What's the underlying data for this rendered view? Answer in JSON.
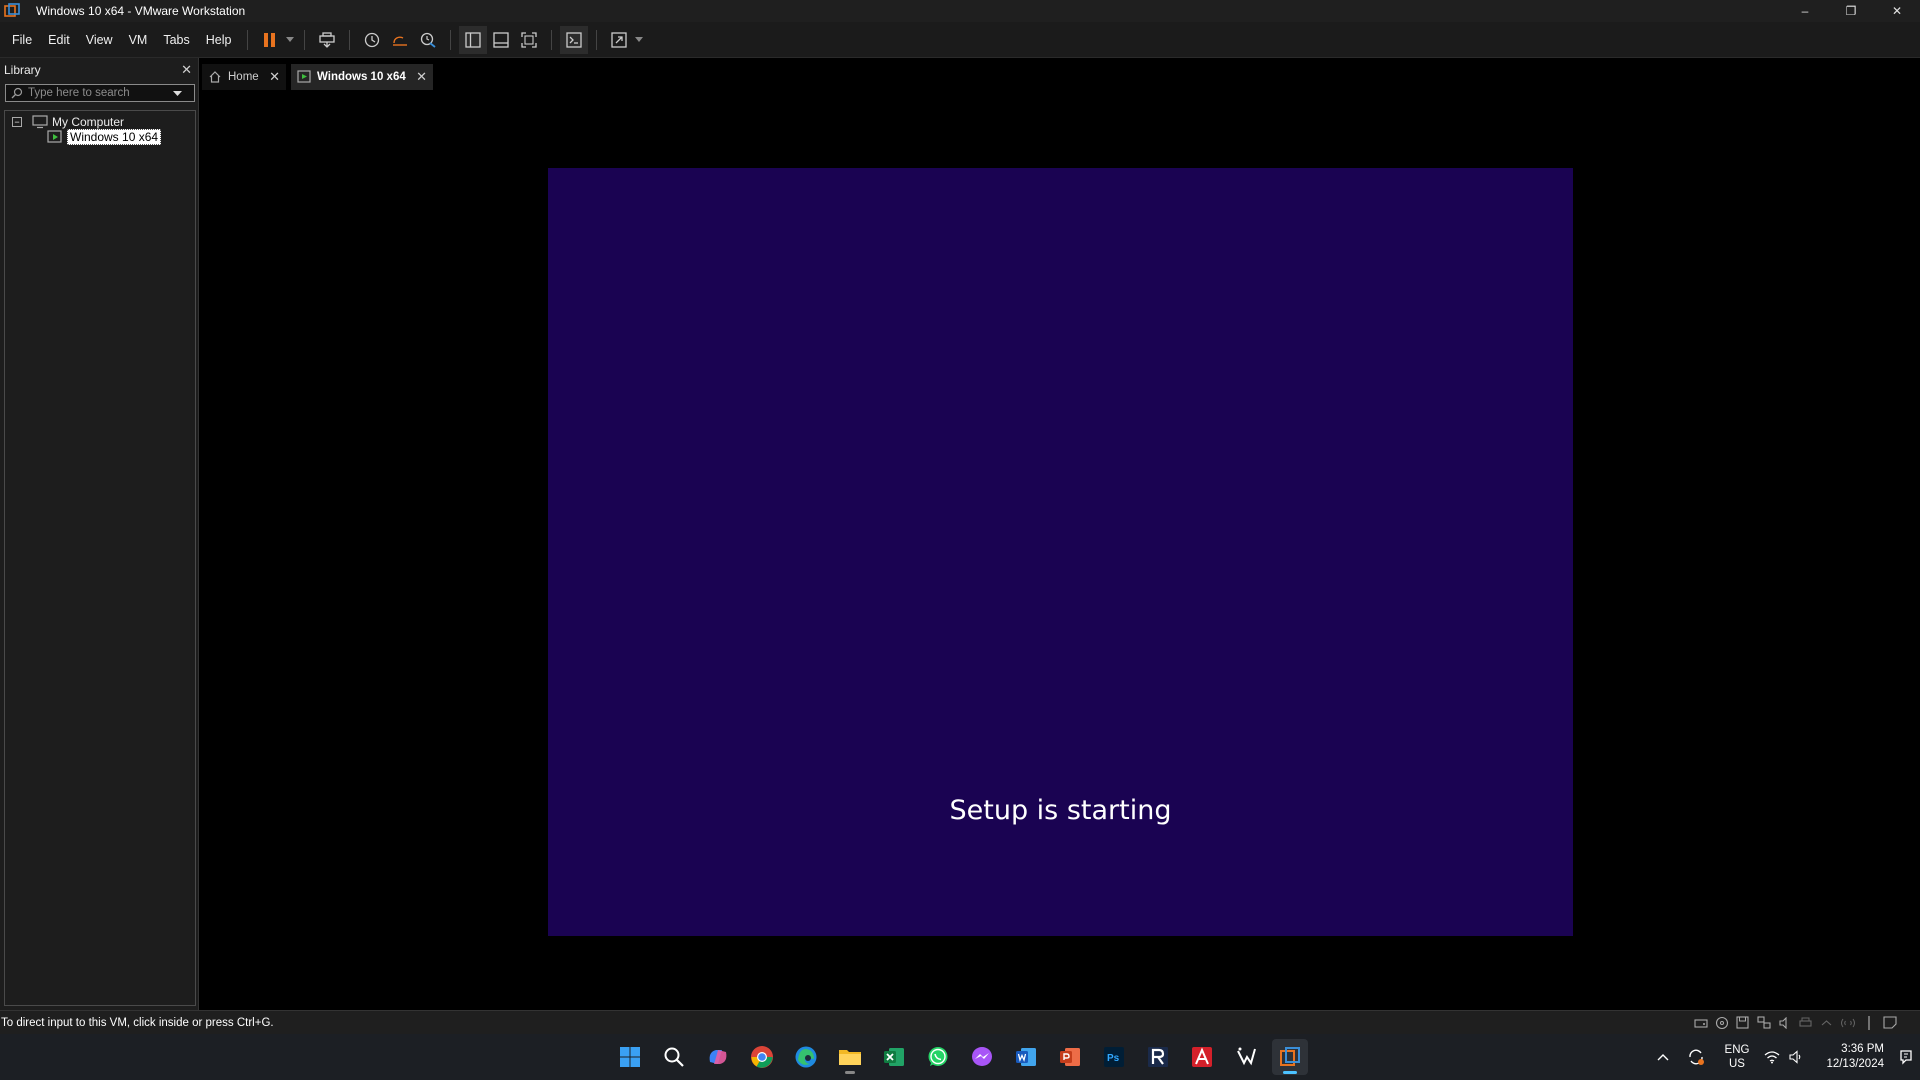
{
  "window": {
    "title": "Windows 10 x64 - VMware Workstation",
    "controls": {
      "minimize": "–",
      "restore": "❐",
      "close": "✕"
    }
  },
  "menu": [
    "File",
    "Edit",
    "View",
    "VM",
    "Tabs",
    "Help"
  ],
  "toolbar": {
    "icons": [
      "pause-icon",
      "send-ctrl-alt-del-icon",
      "snapshot-icon",
      "revert-snapshot-icon",
      "snapshot-manager-icon",
      "show-library-icon",
      "thumbnail-bar-icon",
      "full-screen-icon",
      "console-view-icon",
      "stretch-guest-icon"
    ],
    "accent": "#e8731f"
  },
  "library": {
    "title": "Library",
    "close": "✕",
    "search_placeholder": "Type here to search",
    "tree": {
      "root": {
        "label": "My Computer",
        "toggle": "−"
      },
      "vm": {
        "label": "Windows 10 x64"
      }
    }
  },
  "tabs": [
    {
      "label": "Home",
      "close": "✕"
    },
    {
      "label": "Windows 10 x64",
      "close": "✕"
    }
  ],
  "guest": {
    "message": "Setup is starting",
    "background": "#1a0352"
  },
  "status": {
    "text": "To direct input to this VM, click inside or press Ctrl+G.",
    "device_icons": [
      "hard-disk-icon",
      "cd-dvd-icon",
      "floppy-icon",
      "network-icon",
      "sound-icon",
      "printer-icon",
      "usb-icon",
      "display-icon",
      "message-log-icon"
    ]
  },
  "taskbar": {
    "apps": [
      "start-icon",
      "search-icon",
      "copilot-icon",
      "chrome-icon",
      "edge-icon",
      "file-explorer-icon",
      "excel-icon",
      "whatsapp-icon",
      "messenger-icon",
      "word-icon",
      "powerpoint-icon",
      "photoshop-icon",
      "r-app-icon",
      "acrobat-icon",
      "vector-app-icon",
      "vmware-icon"
    ],
    "tray": {
      "lang_top": "ENG",
      "lang_bottom": "US",
      "time": "3:36 PM",
      "date": "12/13/2024"
    }
  }
}
